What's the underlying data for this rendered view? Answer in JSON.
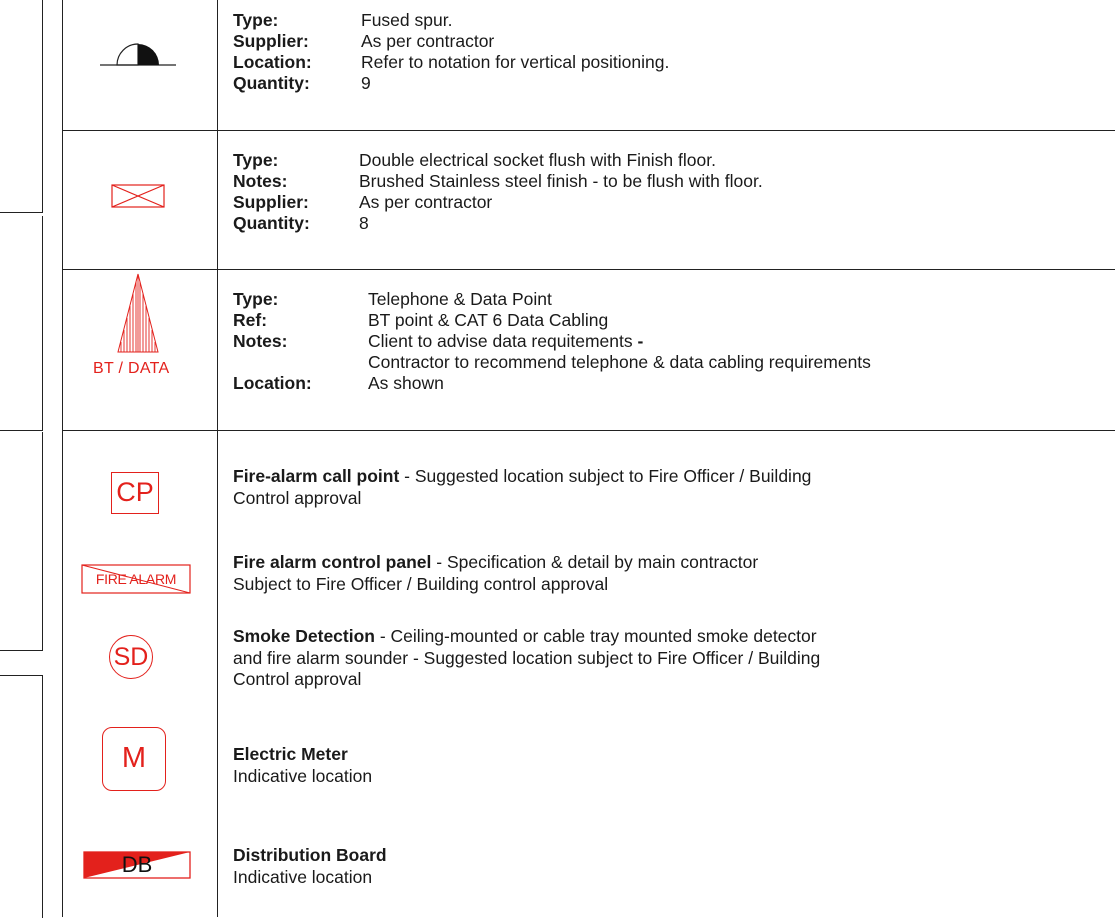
{
  "sections": {
    "fused_spur": {
      "rows": [
        {
          "label": "Type:",
          "value": "Fused spur."
        },
        {
          "label": "Supplier:",
          "value": "As per contractor"
        },
        {
          "label": "Location:",
          "value": "Refer to notation for vertical positioning."
        },
        {
          "label": "Quantity:",
          "value": "9"
        }
      ]
    },
    "floor_socket": {
      "rows": [
        {
          "label": "Type:",
          "value": "Double electrical socket flush with Finish floor."
        },
        {
          "label": "Notes:",
          "value": "Brushed Stainless steel finish - to be flush with floor."
        },
        {
          "label": "Supplier:",
          "value": "As per contractor"
        },
        {
          "label": "Quantity:",
          "value": "8"
        }
      ]
    },
    "bt_data": {
      "symbol_label": "BT / DATA",
      "rows": [
        {
          "label": "Type:",
          "value": "Telephone & Data Point"
        },
        {
          "label": "Ref:",
          "value": "BT point & CAT 6 Data Cabling"
        },
        {
          "label": "Notes:",
          "value": "Client to advise data requitements"
        },
        {
          "label": "",
          "value": "Contractor to recommend telephone & data cabling requirements"
        },
        {
          "label": "Location:",
          "value": "As shown"
        }
      ],
      "notes_suffix": " -"
    },
    "fire": {
      "call_point": {
        "symbol": "CP",
        "title": "Fire-alarm call point",
        "line1": " - Suggested location subject to Fire Officer / Building",
        "line2": "Control approval"
      },
      "control_panel": {
        "symbol": "FIRE ALARM",
        "title": "Fire alarm control panel",
        "line1": " - Specification & detail by main contractor",
        "line2": "Subject to Fire Officer / Building control approval"
      },
      "smoke": {
        "symbol": "SD",
        "title": "Smoke Detection",
        "line1": " - Ceiling-mounted or cable tray mounted smoke detector",
        "line2": "and fire alarm sounder - Suggested location subject to Fire Officer / Building",
        "line3": "Control approval"
      },
      "meter": {
        "symbol": "M",
        "title": "Electric Meter",
        "line2": "Indicative location"
      },
      "db": {
        "symbol": "DB",
        "title": "Distribution Board",
        "line2": "Indicative location"
      }
    }
  },
  "colors": {
    "symbol_red": "#e3211c",
    "line": "#222222",
    "text": "#1a1a1a"
  }
}
